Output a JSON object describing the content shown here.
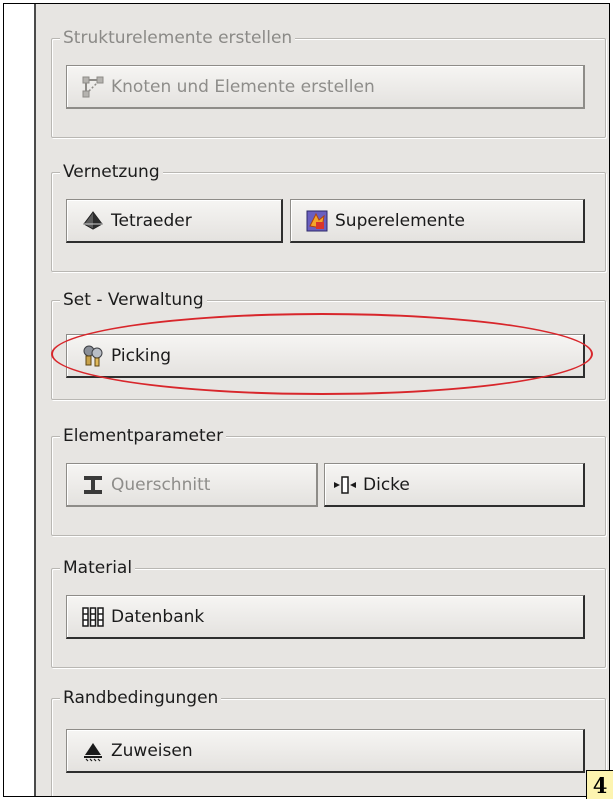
{
  "groups": {
    "structure": {
      "title": "Strukturelemente erstellen",
      "create_nodes_label": "Knoten und Elemente erstellen"
    },
    "meshing": {
      "title": "Vernetzung",
      "tetra_label": "Tetraeder",
      "superelement_label": "Superelemente"
    },
    "set_management": {
      "title": "Set - Verwaltung",
      "picking_label": "Picking"
    },
    "element_params": {
      "title": "Elementparameter",
      "cross_section_label": "Querschnitt",
      "thickness_label": "Dicke"
    },
    "material": {
      "title": "Material",
      "database_label": "Datenbank"
    },
    "boundary": {
      "title": "Randbedingungen",
      "assign_label": "Zuweisen"
    }
  },
  "page_number": "4",
  "colors": {
    "panel_bg": "#e7e5e2",
    "annotation": "#d8262b",
    "badge_bg": "#fdf4b0"
  },
  "icons": {
    "create_nodes": "node-element-icon",
    "tetra": "tetrahedron-icon",
    "superelement": "superelement-icon",
    "picking": "picking-icon",
    "cross_section": "i-beam-icon",
    "thickness": "thickness-icon",
    "database": "material-database-icon",
    "assign": "boundary-support-icon"
  }
}
